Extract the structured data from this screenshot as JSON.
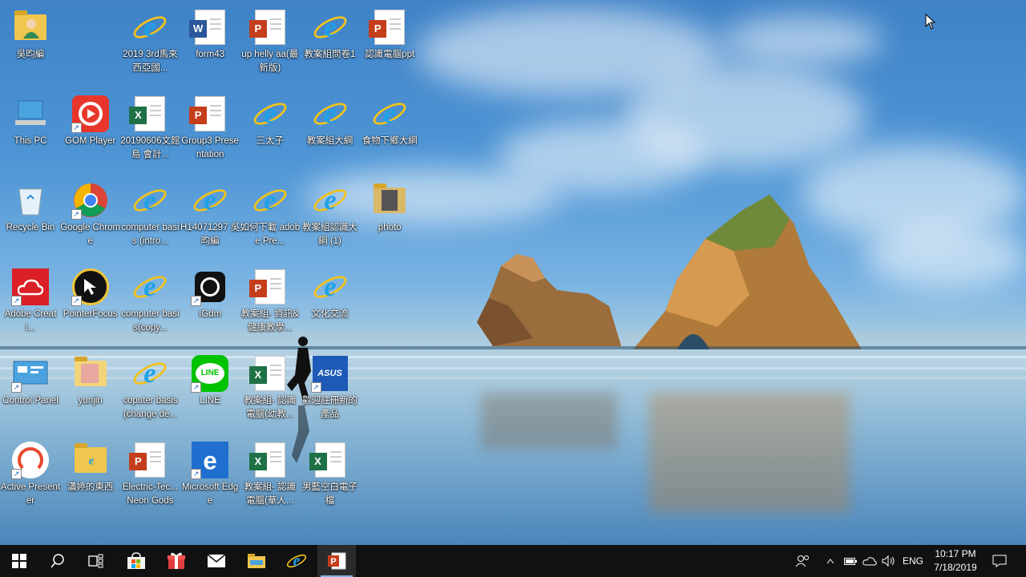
{
  "desktop": {
    "icons": [
      {
        "label": "吳昀編",
        "icon": "user-folder-icon"
      },
      {
        "label": "2019 3rd馬來西亞國...",
        "icon": "internet-explorer-icon"
      },
      {
        "label": "form43",
        "icon": "word-document-icon"
      },
      {
        "label": "up helly aa(最新版)",
        "icon": "powerpoint-document-icon"
      },
      {
        "label": "教案組問卷1",
        "icon": "internet-explorer-icon"
      },
      {
        "label": "認識電腦ppt",
        "icon": "powerpoint-document-icon"
      },
      {
        "label": "This PC",
        "icon": "this-pc-icon"
      },
      {
        "label": "GOM Player",
        "icon": "gom-player-icon"
      },
      {
        "label": "20190606文館島 會計...",
        "icon": "excel-document-icon"
      },
      {
        "label": "Group3 Presentation",
        "icon": "powerpoint-document-icon"
      },
      {
        "label": "三太子",
        "icon": "internet-explorer-icon"
      },
      {
        "label": "教案組大綱",
        "icon": "internet-explorer-icon"
      },
      {
        "label": "食物下鄉大綱",
        "icon": "internet-explorer-icon"
      },
      {
        "label": "Recycle Bin",
        "icon": "recycle-bin-icon"
      },
      {
        "label": "Google Chrome",
        "icon": "chrome-icon"
      },
      {
        "label": "computer basis (intro...",
        "icon": "internet-explorer-icon"
      },
      {
        "label": "H14071297 吳昀編",
        "icon": "internet-explorer-icon"
      },
      {
        "label": "如何下載 adobe Pre...",
        "icon": "internet-explorer-icon"
      },
      {
        "label": "教案組認識大綱 (1)",
        "icon": "internet-explorer-icon"
      },
      {
        "label": "photo",
        "icon": "photo-folder-icon"
      },
      {
        "label": "Adobe Creati...",
        "icon": "adobe-creative-cloud-icon"
      },
      {
        "label": "PointerFocus",
        "icon": "pointerfocus-icon"
      },
      {
        "label": "computer basis(copy...",
        "icon": "internet-explorer-icon"
      },
      {
        "label": "IGdm",
        "icon": "igdm-icon"
      },
      {
        "label": "教案組- 資訊&健康教學...",
        "icon": "powerpoint-document-icon"
      },
      {
        "label": "文化交流",
        "icon": "internet-explorer-icon"
      },
      {
        "label": "Control Panel",
        "icon": "control-panel-icon"
      },
      {
        "label": "yunjin",
        "icon": "image-folder-icon"
      },
      {
        "label": "coputer basis (change de...",
        "icon": "internet-explorer-icon"
      },
      {
        "label": "LINE",
        "icon": "line-icon"
      },
      {
        "label": "教案組- 認識電腦(幼教...",
        "icon": "excel-document-icon"
      },
      {
        "label": "歡迎註冊新的產品",
        "icon": "asus-icon"
      },
      {
        "label": "Active Presenter",
        "icon": "active-presenter-icon"
      },
      {
        "label": "瀟婷的東西",
        "icon": "ie-folder-icon"
      },
      {
        "label": "Electric-Tec... Neon Gods",
        "icon": "powerpoint-document-icon"
      },
      {
        "label": "Microsoft Edge",
        "icon": "edge-icon"
      },
      {
        "label": "教案組- 認識電腦(華人...",
        "icon": "excel-document-icon"
      },
      {
        "label": "男藍空白電子檔",
        "icon": "excel-document-icon"
      }
    ]
  },
  "taskbar": {
    "start": "windows-start-icon",
    "search": "search-icon",
    "pinned": [
      {
        "name": "task-view-icon"
      },
      {
        "name": "microsoft-store-icon"
      },
      {
        "name": "gift-icon"
      },
      {
        "name": "mail-icon"
      },
      {
        "name": "file-explorer-icon"
      },
      {
        "name": "internet-explorer-icon"
      },
      {
        "name": "powerpoint-icon"
      }
    ],
    "language": "ENG",
    "time": "10:17 PM",
    "date": "7/18/2019"
  },
  "colors": {
    "excel": "#1e7145",
    "powerpoint": "#c43e1c",
    "word": "#2b579a",
    "ie": "#1ea1e8",
    "taskbar": "#111111"
  }
}
